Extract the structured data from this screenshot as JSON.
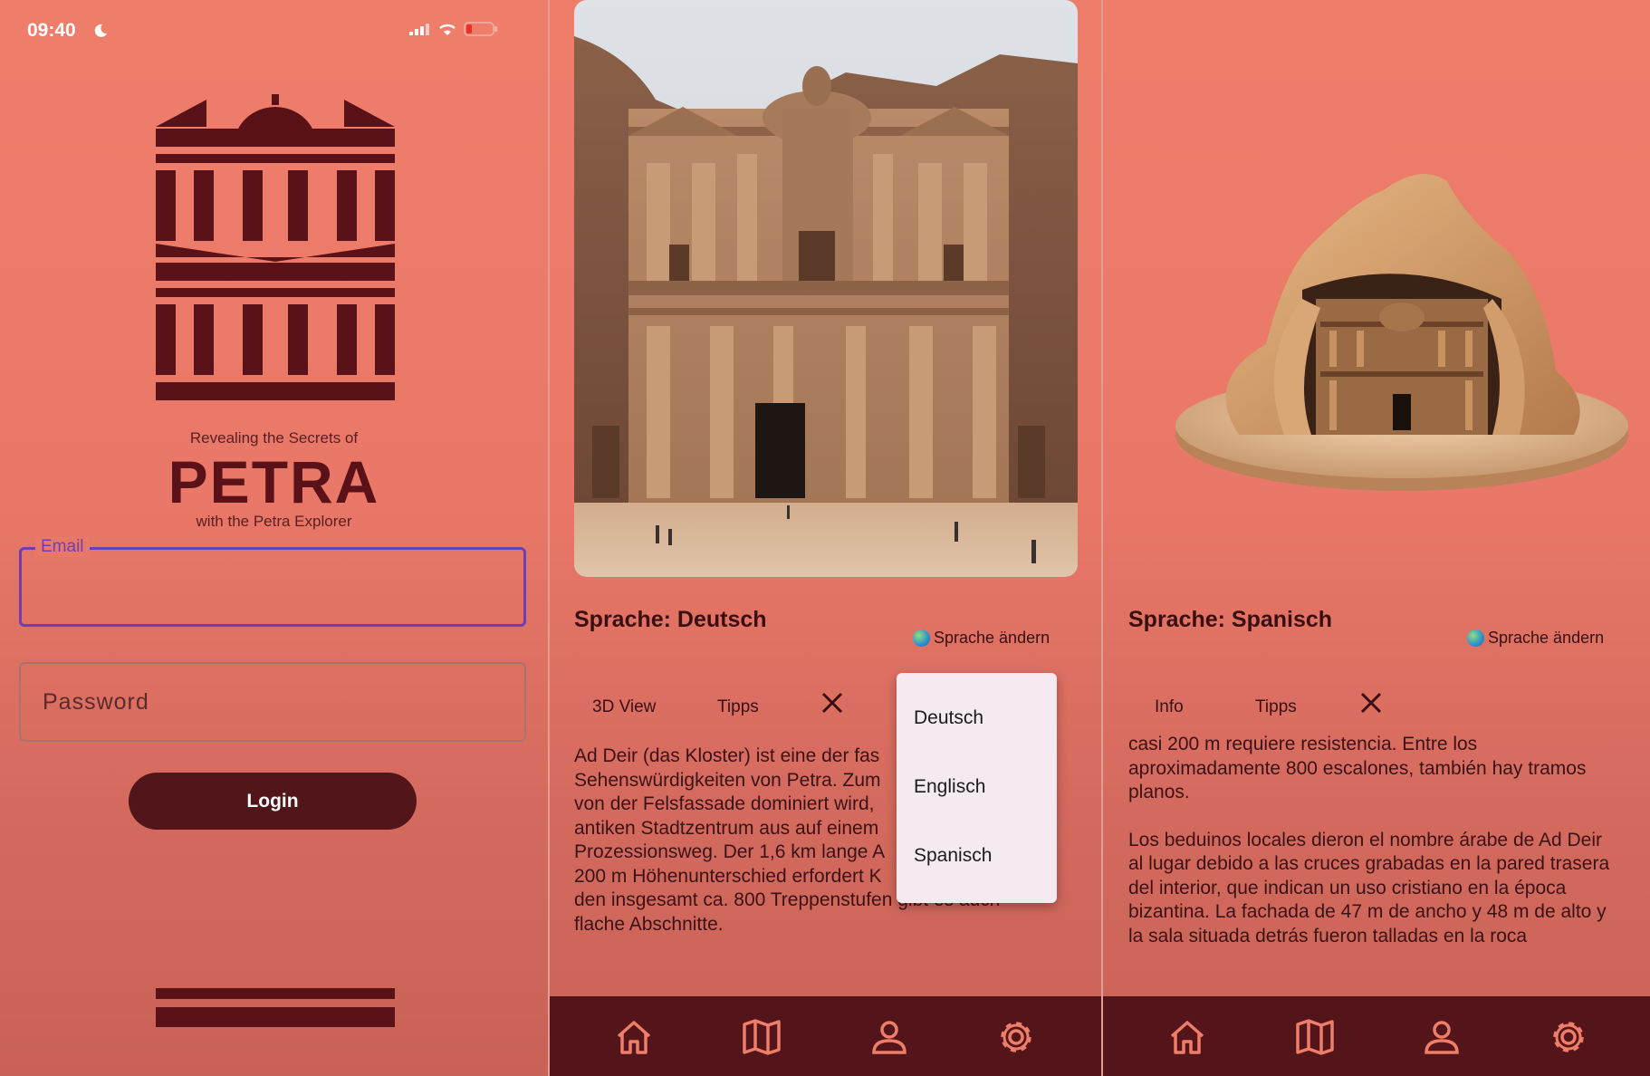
{
  "status_bar": {
    "time": "09:40"
  },
  "login_screen": {
    "tagline_top": "Revealing the Secrets of",
    "brand": "PETRA",
    "tagline_bottom": "with the Petra Explorer",
    "email_label": "Email",
    "email_value": "",
    "password_placeholder": "Password",
    "login_label": "Login"
  },
  "detail_german": {
    "language_title": "Sprache: Deutsch",
    "change_language": "Sprache ändern",
    "tabs": [
      "3D View",
      "Tipps"
    ],
    "body": "Ad Deir (das Kloster) ist eine der fas… Sehenswürdigkeiten von Petra. Zum… von der Felsfassade dominiert wird,… antiken Stadtzentrum aus auf einem… Prozessionsweg. Der 1,6 km lange A… 200 m Höhenunterschied erfordert K… den insgesamt ca. 800 Treppenstufen gibt es auch flache Abschnitte.",
    "body_lines": [
      "Ad Deir (das Kloster) ist eine der fas",
      "Sehenswürdigkeiten von Petra. Zum",
      "von der Felsfassade dominiert wird,",
      "antiken Stadtzentrum aus auf einem",
      "Prozessionsweg. Der 1,6 km lange A",
      "200 m Höhenunterschied erfordert K",
      "den insgesamt ca. 800 Treppenstufen gibt es auch",
      "flache Abschnitte."
    ],
    "dropdown_options": [
      "Deutsch",
      "Englisch",
      "Spanisch"
    ]
  },
  "detail_spanish": {
    "language_title": "Sprache: Spanisch",
    "change_language": "Sprache ändern",
    "tabs": [
      "Info",
      "Tipps"
    ],
    "body_lines_1": [
      "casi 200 m requiere resistencia. Entre los",
      "aproximadamente 800 escalones, también hay tramos",
      "planos."
    ],
    "body_lines_2": [
      "Los beduinos locales dieron el nombre árabe de Ad Deir",
      "al lugar debido a las cruces grabadas en la pared trasera",
      "del interior, que indican un uso cristiano en la época",
      "bizantina. La fachada de 47 m de ancho y 48 m de alto y",
      "la sala situada detrás fueron talladas en la roca"
    ]
  },
  "nav_icons": [
    "home-icon",
    "map-icon",
    "profile-icon",
    "settings-icon"
  ],
  "colors": {
    "accent": "#521519",
    "focus": "#6b3fb8",
    "background": "#ea7868"
  }
}
